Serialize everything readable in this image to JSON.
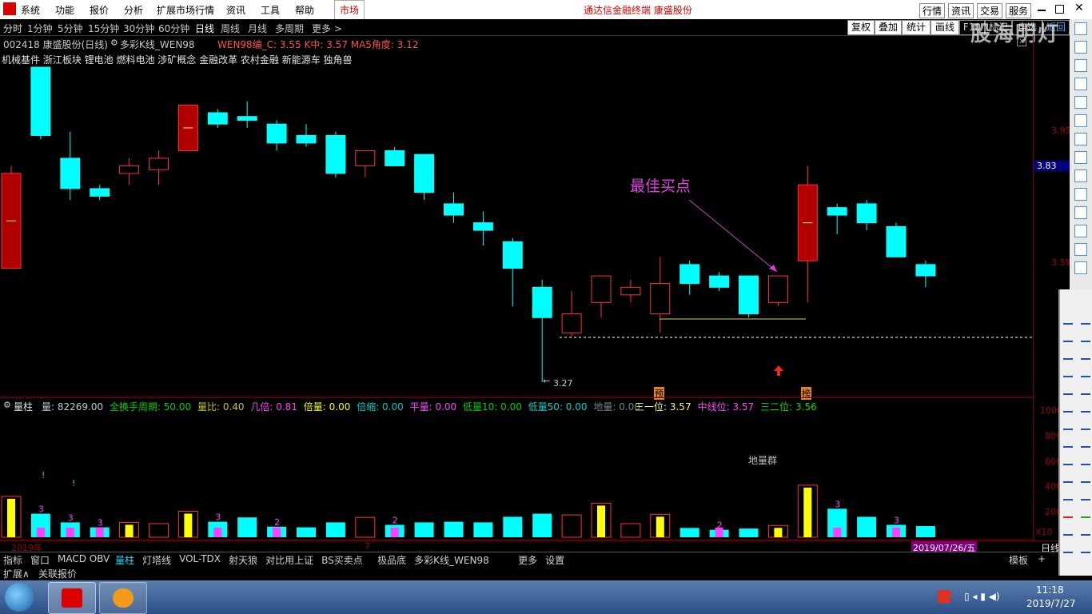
{
  "menu": {
    "items": [
      "系统",
      "功能",
      "报价",
      "分析",
      "扩展市场行情",
      "资讯",
      "工具",
      "帮助"
    ],
    "market_tab": "市场",
    "center_title": "通达信金融终端 康盛股份",
    "right_buttons": [
      "行情",
      "资讯",
      "交易",
      "服务"
    ]
  },
  "periods": {
    "items": [
      "分时",
      "1分钟",
      "5分钟",
      "15分钟",
      "30分钟",
      "60分钟",
      "日线",
      "周线",
      "月线",
      "多周期",
      "更多 >"
    ],
    "active": "日线",
    "right_buttons": [
      "复权",
      "叠加",
      "统计",
      "画线",
      "F10",
      "标记",
      "自选",
      "返回"
    ],
    "watermark": "股海明灯"
  },
  "stock": {
    "header": "002418 康盛股份(日线)",
    "indicator_name": "多彩K线_WEN98",
    "indicator_values": "WEN98编_C: 3.55  K中: 3.57  MA5角度: 3.12",
    "tags": "机械基件    浙江板块    锂电池 燃料电池 涉矿概念 金融改革 农村金融 新能源车 独角兽"
  },
  "annotations": {
    "best_buy": "最佳买点",
    "low_label": "3.27",
    "marker_1": "预",
    "marker_2": "榜",
    "volume_note": "地量群",
    "vol_marks": [
      "3",
      "3",
      "3",
      "3",
      "2",
      "2",
      "2",
      "3",
      "3"
    ],
    "excl": "!"
  },
  "price_axis": {
    "ticks": [
      "3.95",
      "3.59"
    ],
    "current": "3.83"
  },
  "volume": {
    "title": "量柱",
    "values_line": [
      {
        "label": "量: 82269.00",
        "color": "#c8c8c8"
      },
      {
        "label": "全换手周期: 50.00",
        "color": "#00d000"
      },
      {
        "label": "量比: 0.40",
        "color": "#c8c800"
      },
      {
        "label": "几倍: 0.81",
        "color": "#ff40ff"
      },
      {
        "label": "倍量: 0.00",
        "color": "#ffff00"
      },
      {
        "label": "倍缩: 0.00",
        "color": "#00c8c8"
      },
      {
        "label": "平量: 0.00",
        "color": "#ff40ff"
      },
      {
        "label": "低量10: 0.00",
        "color": "#00d000"
      },
      {
        "label": "低量50: 0.00",
        "color": "#00d0d0"
      },
      {
        "label": "地量: 0.00",
        "color": "#808080"
      }
    ],
    "levels": [
      {
        "label": "三一位: 3.57",
        "color": "#ffff40"
      },
      {
        "label": "中线位: 3.57",
        "color": "#ff40ff"
      },
      {
        "label": "三二位: 3.56",
        "color": "#00e000"
      }
    ],
    "axis_ticks": [
      "1000",
      "800",
      "600",
      "400",
      "200",
      "X10"
    ]
  },
  "date_axis": {
    "left": "2019年",
    "mid": "7",
    "current": "2019/07/26/五",
    "right": "日线"
  },
  "bottom_tabs": [
    "指标",
    "窗口",
    "MACD",
    "OBV",
    "量柱",
    "灯塔线",
    "VOL-TDX",
    "射天狼",
    "对比用上证",
    "BS买卖点",
    "极品底",
    "多彩K线_WEN98",
    "更多",
    "设置"
  ],
  "bottom_tabs_active": "量柱",
  "bottom_right": [
    "模板",
    "+"
  ],
  "bottom_row2": [
    "扩展∧",
    "关联报价"
  ],
  "taskbar": {
    "time": "11:18",
    "date": "2019/7/27"
  },
  "colors": {
    "up": "#ff3232",
    "down": "#00ffff",
    "ma": "#ffff00",
    "accent": "#c020c0"
  },
  "chart_data": {
    "type": "candlestick",
    "symbol": "002418",
    "candles": [
      {
        "o": 3.82,
        "h": 3.84,
        "l": 3.57,
        "c": 3.57,
        "dir": "up",
        "fill": true
      },
      {
        "o": 4.1,
        "h": 4.1,
        "l": 3.91,
        "c": 3.92,
        "dir": "down"
      },
      {
        "o": 3.86,
        "h": 3.93,
        "l": 3.75,
        "c": 3.78,
        "dir": "down"
      },
      {
        "o": 3.78,
        "h": 3.79,
        "l": 3.75,
        "c": 3.76,
        "dir": "down"
      },
      {
        "o": 3.82,
        "h": 3.86,
        "l": 3.79,
        "c": 3.84,
        "dir": "up"
      },
      {
        "o": 3.83,
        "h": 3.88,
        "l": 3.79,
        "c": 3.86,
        "dir": "up"
      },
      {
        "o": 3.88,
        "h": 4.0,
        "l": 3.88,
        "c": 4.0,
        "dir": "up",
        "fill": true
      },
      {
        "o": 3.98,
        "h": 3.99,
        "l": 3.94,
        "c": 3.95,
        "dir": "down"
      },
      {
        "o": 3.97,
        "h": 4.01,
        "l": 3.94,
        "c": 3.96,
        "dir": "down"
      },
      {
        "o": 3.95,
        "h": 3.96,
        "l": 3.88,
        "c": 3.9,
        "dir": "down"
      },
      {
        "o": 3.92,
        "h": 3.95,
        "l": 3.89,
        "c": 3.9,
        "dir": "down"
      },
      {
        "o": 3.92,
        "h": 3.93,
        "l": 3.81,
        "c": 3.82,
        "dir": "down"
      },
      {
        "o": 3.84,
        "h": 3.88,
        "l": 3.81,
        "c": 3.88,
        "dir": "up"
      },
      {
        "o": 3.88,
        "h": 3.89,
        "l": 3.84,
        "c": 3.84,
        "dir": "down"
      },
      {
        "o": 3.87,
        "h": 3.87,
        "l": 3.75,
        "c": 3.77,
        "dir": "down"
      },
      {
        "o": 3.74,
        "h": 3.77,
        "l": 3.69,
        "c": 3.71,
        "dir": "down"
      },
      {
        "o": 3.69,
        "h": 3.72,
        "l": 3.63,
        "c": 3.67,
        "dir": "down"
      },
      {
        "o": 3.64,
        "h": 3.65,
        "l": 3.47,
        "c": 3.57,
        "dir": "down"
      },
      {
        "o": 3.52,
        "h": 3.54,
        "l": 3.27,
        "c": 3.44,
        "dir": "down"
      },
      {
        "o": 3.4,
        "h": 3.51,
        "l": 3.39,
        "c": 3.45,
        "dir": "up"
      },
      {
        "o": 3.48,
        "h": 3.55,
        "l": 3.44,
        "c": 3.55,
        "dir": "up"
      },
      {
        "o": 3.5,
        "h": 3.54,
        "l": 3.48,
        "c": 3.52,
        "dir": "up"
      },
      {
        "o": 3.45,
        "h": 3.6,
        "l": 3.4,
        "c": 3.53,
        "dir": "up"
      },
      {
        "o": 3.58,
        "h": 3.59,
        "l": 3.5,
        "c": 3.53,
        "dir": "down"
      },
      {
        "o": 3.55,
        "h": 3.56,
        "l": 3.51,
        "c": 3.52,
        "dir": "down"
      },
      {
        "o": 3.55,
        "h": 3.55,
        "l": 3.44,
        "c": 3.45,
        "dir": "down"
      },
      {
        "o": 3.48,
        "h": 3.55,
        "l": 3.47,
        "c": 3.55,
        "dir": "up"
      },
      {
        "o": 3.59,
        "h": 3.84,
        "l": 3.48,
        "c": 3.79,
        "dir": "up",
        "fill": true
      },
      {
        "o": 3.73,
        "h": 3.74,
        "l": 3.66,
        "c": 3.71,
        "dir": "down"
      },
      {
        "o": 3.74,
        "h": 3.75,
        "l": 3.67,
        "c": 3.69,
        "dir": "down"
      },
      {
        "o": 3.68,
        "h": 3.69,
        "l": 3.6,
        "c": 3.6,
        "dir": "down"
      },
      {
        "o": 3.58,
        "h": 3.59,
        "l": 3.52,
        "c": 3.55,
        "dir": "down"
      }
    ],
    "volumes": [
      330,
      190,
      120,
      80,
      120,
      110,
      210,
      125,
      160,
      85,
      80,
      120,
      160,
      100,
      120,
      125,
      120,
      165,
      190,
      180,
      275,
      110,
      185,
      75,
      60,
      70,
      95,
      420,
      230,
      165,
      100,
      90
    ],
    "y_range": [
      3.27,
      4.1
    ]
  }
}
